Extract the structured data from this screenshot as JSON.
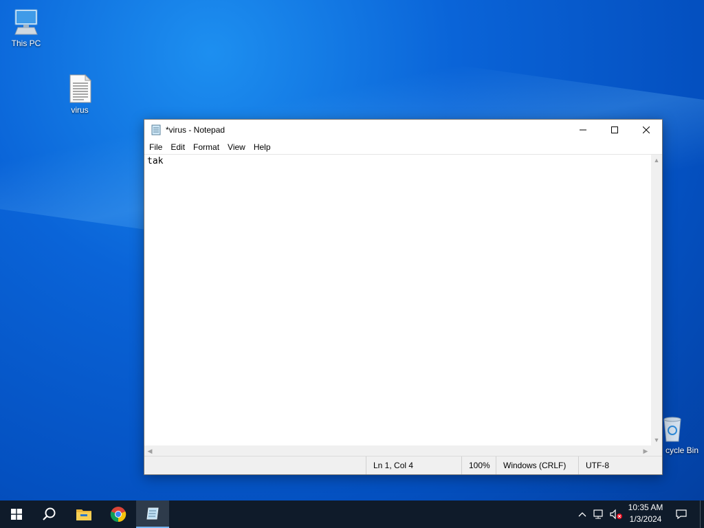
{
  "desktop": {
    "icons": [
      {
        "label": "This PC"
      },
      {
        "label": "virus"
      },
      {
        "label": "cycle Bin"
      }
    ]
  },
  "notepad": {
    "title": "*virus - Notepad",
    "menu": [
      "File",
      "Edit",
      "Format",
      "View",
      "Help"
    ],
    "content": "tak",
    "status": {
      "position": "Ln 1, Col 4",
      "zoom": "100%",
      "line_ending": "Windows (CRLF)",
      "encoding": "UTF-8"
    }
  },
  "taskbar": {
    "time": "10:35 AM",
    "date": "1/3/2024"
  },
  "colors": {
    "taskbar_bg": "#0f1b2a",
    "active_accent": "#79b8f3"
  }
}
